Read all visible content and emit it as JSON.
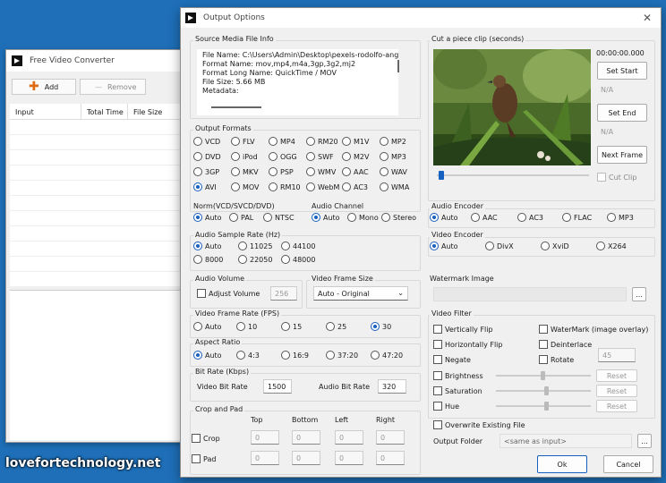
{
  "bg_window": {
    "title": "Free Video Converter",
    "toolbar": {
      "add_label": "Add",
      "remove_label": "Remove"
    },
    "columns": [
      "Input",
      "Total Time",
      "File Size"
    ]
  },
  "dialog": {
    "title": "Output Options",
    "source": {
      "title": "Source Media File Info",
      "lines": [
        "File Name: C:\\Users\\Admin\\Desktop\\pexels-rodolfo-angu",
        "Format Name: mov,mp4,m4a,3gp,3g2,mj2",
        "Format Long Name: QuickTime / MOV",
        "File Size: 5.66 MB",
        "Metadata:"
      ]
    },
    "output_formats": {
      "title": "Output Formats",
      "rows": [
        [
          "VCD",
          "FLV",
          "MP4",
          "RM20",
          "M1V",
          "MP2"
        ],
        [
          "DVD",
          "iPod",
          "OGG",
          "SWF",
          "M2V",
          "MP3"
        ],
        [
          "3GP",
          "MKV",
          "PSP",
          "WMV",
          "AAC",
          "WAV"
        ],
        [
          "AVI",
          "MOV",
          "RM10",
          "WebM",
          "AC3",
          "WMA"
        ]
      ],
      "selected": "AVI"
    },
    "norm": {
      "title": "Norm(VCD/SVCD/DVD)",
      "options": [
        "Auto",
        "PAL",
        "NTSC"
      ],
      "selected": "Auto"
    },
    "audio_channel": {
      "title": "Audio Channel",
      "options": [
        "Auto",
        "Mono",
        "Stereo"
      ],
      "selected": "Auto"
    },
    "sample_rate": {
      "title": "Audio Sample Rate (Hz)",
      "options": [
        "Auto",
        "11025",
        "44100",
        "8000",
        "22050",
        "48000"
      ],
      "selected": "Auto"
    },
    "audio_volume": {
      "title": "Audio Volume",
      "checkbox_label": "Adjust Volume",
      "value": "256"
    },
    "frame_size": {
      "title": "Video Frame Size",
      "value": "Auto - Original"
    },
    "frame_rate": {
      "title": "Video Frame Rate (FPS)",
      "options": [
        "Auto",
        "10",
        "15",
        "25",
        "30"
      ],
      "selected": "30"
    },
    "aspect": {
      "title": "Aspect Ratio",
      "options": [
        "Auto",
        "4:3",
        "16:9",
        "37:20",
        "47:20"
      ],
      "selected": "Auto"
    },
    "bitrate": {
      "title": "Bit Rate (Kbps)",
      "video_label": "Video Bit Rate",
      "video_value": "1500",
      "audio_label": "Audio Bit Rate",
      "audio_value": "320"
    },
    "crop": {
      "title": "Crop and Pad",
      "headers": [
        "Top",
        "Bottom",
        "Left",
        "Right"
      ],
      "crop_label": "Crop",
      "pad_label": "Pad",
      "crop_values": [
        "0",
        "0",
        "0",
        "0"
      ],
      "pad_values": [
        "0",
        "0",
        "0",
        "0"
      ]
    },
    "cut": {
      "title": "Cut a piece clip (seconds)",
      "time": "00:00:00.000",
      "set_start": "Set Start",
      "start_value": "N/A",
      "set_end": "Set End",
      "end_value": "N/A",
      "next_frame": "Next Frame",
      "cut_clip": "Cut Clip"
    },
    "audio_encoder": {
      "title": "Audio Encoder",
      "options": [
        "Auto",
        "AAC",
        "AC3",
        "FLAC",
        "MP3"
      ],
      "selected": "Auto"
    },
    "video_encoder": {
      "title": "Video Encoder",
      "options": [
        "Auto",
        "DivX",
        "XviD",
        "X264"
      ],
      "selected": "Auto"
    },
    "watermark": {
      "title": "Watermark Image",
      "browse": "..."
    },
    "video_filter": {
      "title": "Video Filter",
      "vflip": "Vertically Flip",
      "watermark_overlay": "WaterMark (image overlay)",
      "hflip": "Horizontally Flip",
      "deinterlace": "Deinterlace",
      "negate": "Negate",
      "rotate": "Rotate",
      "rotate_value": "45",
      "brightness": "Brightness",
      "saturation": "Saturation",
      "hue": "Hue",
      "reset": "Reset"
    },
    "overwrite": "Overwrite Existing File",
    "output_folder": {
      "label": "Output Folder",
      "value": "<same as input>",
      "browse": "..."
    },
    "ok": "Ok",
    "cancel": "Cancel"
  },
  "watermark_text": "lovefortechnology.net"
}
